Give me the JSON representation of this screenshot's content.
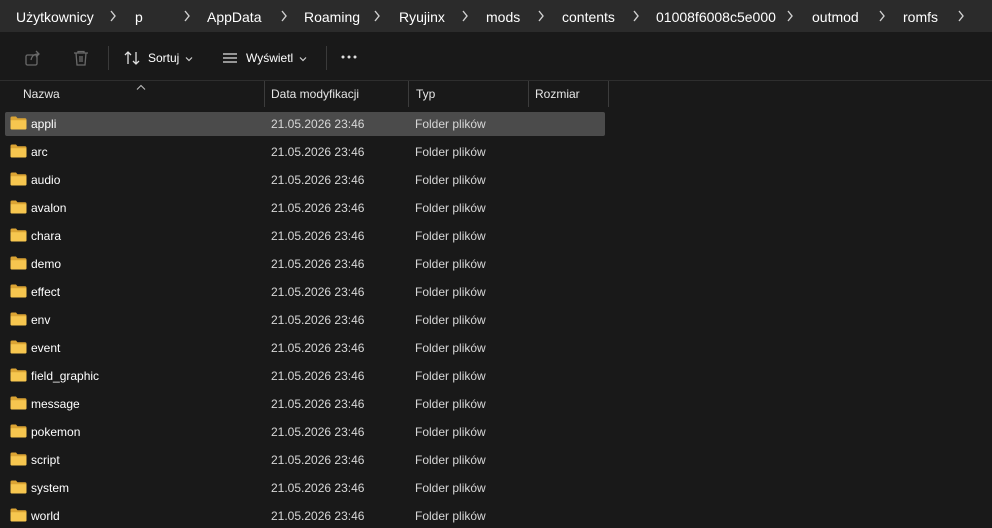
{
  "breadcrumb": {
    "items": [
      "Użytkownicy",
      "p",
      "AppData",
      "Roaming",
      "Ryujinx",
      "mods",
      "contents",
      "01008f6008c5e000",
      "outmod",
      "romfs"
    ]
  },
  "toolbar": {
    "sort_label": "Sortuj",
    "view_label": "Wyświetl",
    "more_label": "..."
  },
  "columns": {
    "name": "Nazwa",
    "date": "Data modyfikacji",
    "type": "Typ",
    "size": "Rozmiar"
  },
  "files": [
    {
      "name": "appli",
      "date": "21.05.2026 23:46",
      "type": "Folder plików",
      "selected": true
    },
    {
      "name": "arc",
      "date": "21.05.2026 23:46",
      "type": "Folder plików"
    },
    {
      "name": "audio",
      "date": "21.05.2026 23:46",
      "type": "Folder plików"
    },
    {
      "name": "avalon",
      "date": "21.05.2026 23:46",
      "type": "Folder plików"
    },
    {
      "name": "chara",
      "date": "21.05.2026 23:46",
      "type": "Folder plików"
    },
    {
      "name": "demo",
      "date": "21.05.2026 23:46",
      "type": "Folder plików"
    },
    {
      "name": "effect",
      "date": "21.05.2026 23:46",
      "type": "Folder plików"
    },
    {
      "name": "env",
      "date": "21.05.2026 23:46",
      "type": "Folder plików"
    },
    {
      "name": "event",
      "date": "21.05.2026 23:46",
      "type": "Folder plików"
    },
    {
      "name": "field_graphic",
      "date": "21.05.2026 23:46",
      "type": "Folder plików"
    },
    {
      "name": "message",
      "date": "21.05.2026 23:46",
      "type": "Folder plików"
    },
    {
      "name": "pokemon",
      "date": "21.05.2026 23:46",
      "type": "Folder plików"
    },
    {
      "name": "script",
      "date": "21.05.2026 23:46",
      "type": "Folder plików"
    },
    {
      "name": "system",
      "date": "21.05.2026 23:46",
      "type": "Folder plików"
    },
    {
      "name": "world",
      "date": "21.05.2026 23:46",
      "type": "Folder plików"
    }
  ],
  "colors": {
    "background": "#191919",
    "breadcrumb_bg": "#2b2b2b",
    "selected_row": "#4b4b4b",
    "folder": "#f0c24a"
  }
}
